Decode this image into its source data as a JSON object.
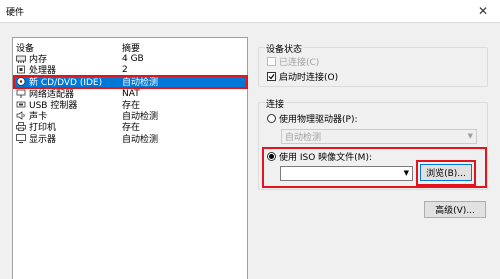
{
  "window": {
    "title": "硬件",
    "close": "✕"
  },
  "device_list": {
    "headers": {
      "device": "设备",
      "summary": "摘要"
    },
    "rows": [
      {
        "icon": "memory-icon",
        "name": "内存",
        "summary": "4 GB"
      },
      {
        "icon": "cpu-icon",
        "name": "处理器",
        "summary": "2"
      },
      {
        "icon": "cd-dvd-icon",
        "name": "新 CD/DVD (IDE)",
        "summary": "自动检测"
      },
      {
        "icon": "network-adapter-icon",
        "name": "网络适配器",
        "summary": "NAT"
      },
      {
        "icon": "usb-icon",
        "name": "USB 控制器",
        "summary": "存在"
      },
      {
        "icon": "sound-card-icon",
        "name": "声卡",
        "summary": "自动检测"
      },
      {
        "icon": "printer-icon",
        "name": "打印机",
        "summary": "存在"
      },
      {
        "icon": "display-icon",
        "name": "显示器",
        "summary": "自动检测"
      }
    ]
  },
  "device_status": {
    "title": "设备状态",
    "connected": {
      "label": "已连接(C)",
      "checked": false,
      "enabled": false
    },
    "connect_on_power_on": {
      "label": "启动时连接(O)",
      "checked": true,
      "enabled": true
    }
  },
  "connection": {
    "title": "连接",
    "physical_drive": {
      "label": "使用物理驱动器(P):",
      "selected": false
    },
    "physical_drive_value": "自动检测",
    "iso_image": {
      "label": "使用 ISO 映像文件(M):",
      "selected": true
    },
    "iso_path_value": "",
    "browse_label": "浏览(B)..."
  },
  "advanced_label": "高级(V)...",
  "colors": {
    "selection": "#0078d7",
    "highlight_outline": "#e3141b"
  }
}
